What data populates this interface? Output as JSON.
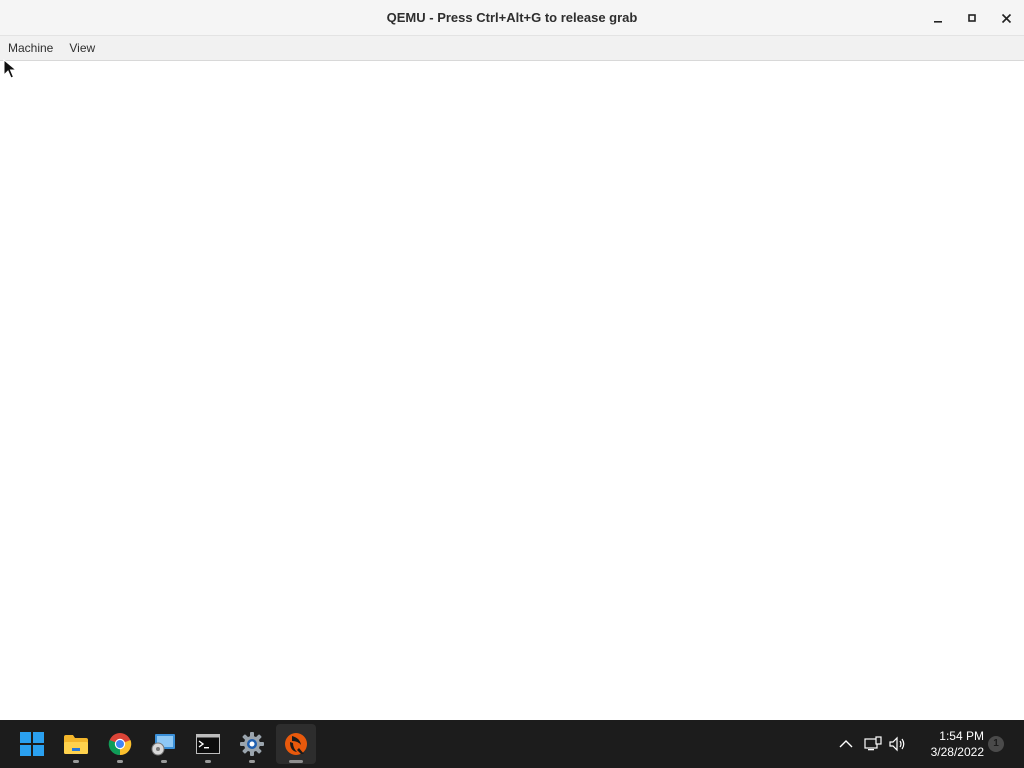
{
  "window": {
    "title": "QEMU - Press Ctrl+Alt+G to release grab",
    "controls": [
      "minimize-icon",
      "maximize-icon",
      "close-icon"
    ]
  },
  "menubar": {
    "items": [
      {
        "label": "Machine"
      },
      {
        "label": "View"
      }
    ]
  },
  "taskbar": {
    "apps": [
      {
        "name": "start",
        "icon": "windows-start-icon"
      },
      {
        "name": "file-explorer",
        "icon": "folder-icon"
      },
      {
        "name": "chrome",
        "icon": "chrome-icon"
      },
      {
        "name": "network-drive",
        "icon": "network-drive-icon"
      },
      {
        "name": "terminal",
        "icon": "terminal-icon"
      },
      {
        "name": "settings",
        "icon": "gear-icon"
      },
      {
        "name": "qemu",
        "icon": "qemu-icon",
        "active": true
      }
    ],
    "tray": {
      "time": "1:54 PM",
      "date": "3/28/2022",
      "notification_count": "1"
    }
  },
  "colors": {
    "taskbar_bg": "#1c1c1c",
    "titlebar_bg": "#f5f5f5",
    "menubar_bg": "#f1f1f1",
    "display_bg": "#ffffff"
  }
}
